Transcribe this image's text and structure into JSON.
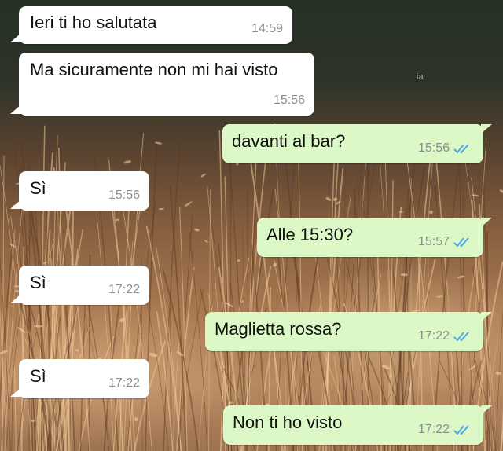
{
  "watermark": "ia",
  "colors": {
    "incoming_bubble": "#ffffff",
    "outgoing_bubble": "#dcf8c6",
    "read_ticks": "#4fa8e6"
  },
  "messages": [
    {
      "direction": "in",
      "text": "Ieri ti ho salutata",
      "time": "14:59"
    },
    {
      "direction": "in",
      "text": "Ma sicuramente non mi hai visto",
      "time": "15:56"
    },
    {
      "direction": "out",
      "text": "davanti al bar?",
      "time": "15:56",
      "status_icon": "double-check-read-icon"
    },
    {
      "direction": "in",
      "text": "Sì",
      "time": "15:56"
    },
    {
      "direction": "out",
      "text": "Alle 15:30?",
      "time": "15:57",
      "status_icon": "double-check-read-icon"
    },
    {
      "direction": "in",
      "text": "Sì",
      "time": "17:22"
    },
    {
      "direction": "out",
      "text": "Maglietta rossa?",
      "time": "17:22",
      "status_icon": "double-check-read-icon"
    },
    {
      "direction": "in",
      "text": "Sì",
      "time": "17:22"
    },
    {
      "direction": "out",
      "text": "Non ti ho visto",
      "time": "17:22",
      "status_icon": "double-check-read-icon"
    }
  ]
}
